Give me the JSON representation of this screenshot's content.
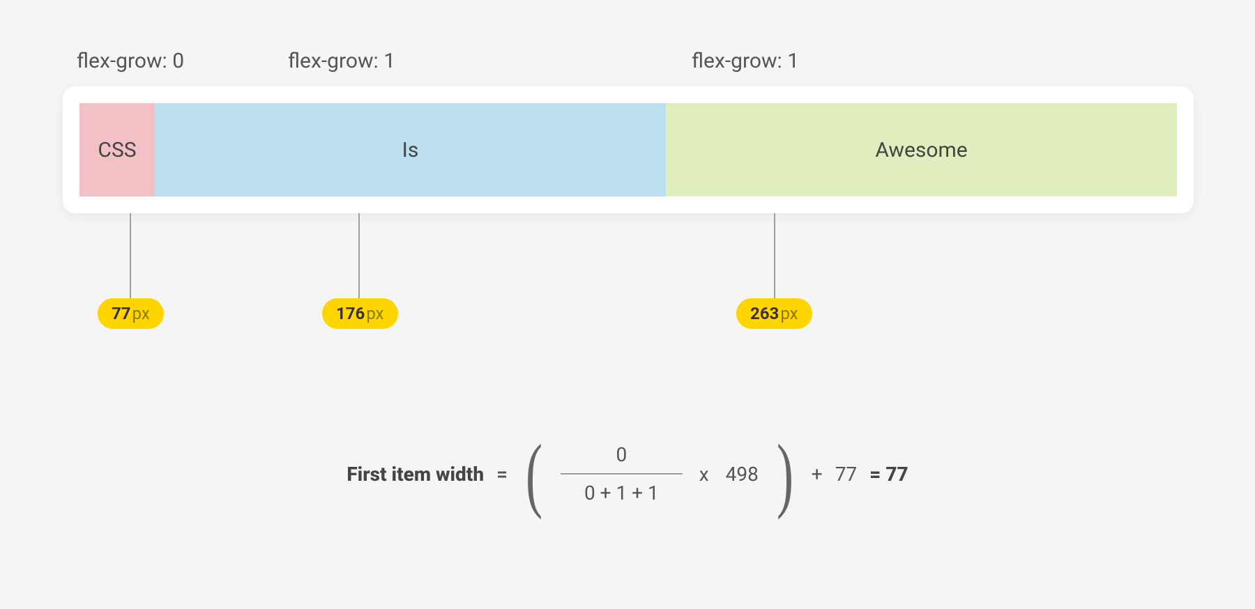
{
  "labels": {
    "item1": "flex-grow: 0",
    "item2": "flex-grow: 1",
    "item3": "flex-grow: 1"
  },
  "boxes": {
    "a": "CSS",
    "b": "Is",
    "c": "Awesome"
  },
  "pills": {
    "a_value": "77",
    "a_unit": "px",
    "b_value": "176",
    "b_unit": "px",
    "c_value": "263",
    "c_unit": "px"
  },
  "formula": {
    "lhs": "First item width",
    "eq1": "=",
    "numerator": "0",
    "denominator": "0 + 1 + 1",
    "times": "x",
    "multiplier": "498",
    "plus": "+",
    "addend": "77",
    "eq2": "= 77"
  }
}
